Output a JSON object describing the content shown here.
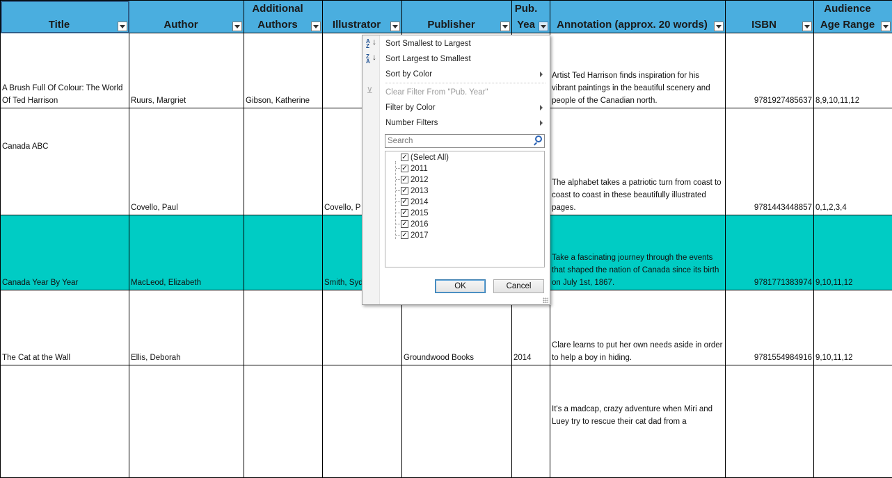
{
  "columns": [
    {
      "label": "Title",
      "selected": true
    },
    {
      "label": "Author"
    },
    {
      "label": "Additional Authors"
    },
    {
      "label": "Illustrator"
    },
    {
      "label": "Publisher"
    },
    {
      "label": "Pub. Yea",
      "filter_open": true
    },
    {
      "label": "Annotation (approx. 20 words)"
    },
    {
      "label": "ISBN"
    },
    {
      "label": "Audience Age Range"
    }
  ],
  "rows": [
    {
      "title": "A Brush Full Of Colour: The World Of Ted Harrison",
      "author": "Ruurs, Margriet",
      "additional": "Gibson, Katherine",
      "illustrator": "",
      "publisher": "",
      "year": "",
      "annotation": "Artist Ted Harrison finds inspiration for his vibrant paintings in the beautiful scenery and people of the Canadian north.",
      "isbn": "9781927485637",
      "age": "8,9,10,11,12",
      "highlight": false
    },
    {
      "title": "Canada ABC",
      "author": "Covello, Paul",
      "additional": "",
      "illustrator": "Covello, P",
      "publisher": "",
      "year": "",
      "annotation": "The alphabet takes a patriotic turn from coast to coast to coast in these beautifully illustrated pages.",
      "isbn": "9781443448857",
      "age": "0,1,2,3,4",
      "highlight": false
    },
    {
      "title": "Canada Year By Year",
      "author": "MacLeod, Elizabeth",
      "additional": "",
      "illustrator": "Smith, Syd",
      "publisher": "",
      "year": "",
      "annotation": "Take a fascinating journey through the events that shaped the nation of Canada since its birth on July 1st, 1867.",
      "isbn": "9781771383974",
      "age": "9,10,11,12",
      "highlight": true
    },
    {
      "title": "The Cat at the Wall",
      "author": "Ellis, Deborah",
      "additional": "",
      "illustrator": "",
      "publisher": "Groundwood Books",
      "year": "2014",
      "annotation": "Clare learns to put her own needs aside in order to help a boy in hiding.",
      "isbn": "9781554984916",
      "age": "9,10,11,12",
      "highlight": false
    },
    {
      "title": "",
      "author": "",
      "additional": "",
      "illustrator": "",
      "publisher": "",
      "year": "",
      "annotation": "It's a madcap, crazy adventure when Miri and Luey try to rescue their cat dad from a",
      "isbn": "",
      "age": "",
      "highlight": false
    }
  ],
  "filter_menu": {
    "sort_asc": "Sort Smallest to Largest",
    "sort_desc": "Sort Largest to Smallest",
    "sort_by_color": "Sort by Color",
    "clear_filter": "Clear Filter From \"Pub. Year\"",
    "filter_by_color": "Filter by Color",
    "number_filters": "Number Filters",
    "search_placeholder": "Search",
    "select_all": "(Select All)",
    "years": [
      "2011",
      "2012",
      "2013",
      "2014",
      "2015",
      "2016",
      "2017"
    ],
    "ok": "OK",
    "cancel": "Cancel"
  },
  "colors": {
    "header": "#4aaedf",
    "highlight_row": "#00ccc4"
  }
}
